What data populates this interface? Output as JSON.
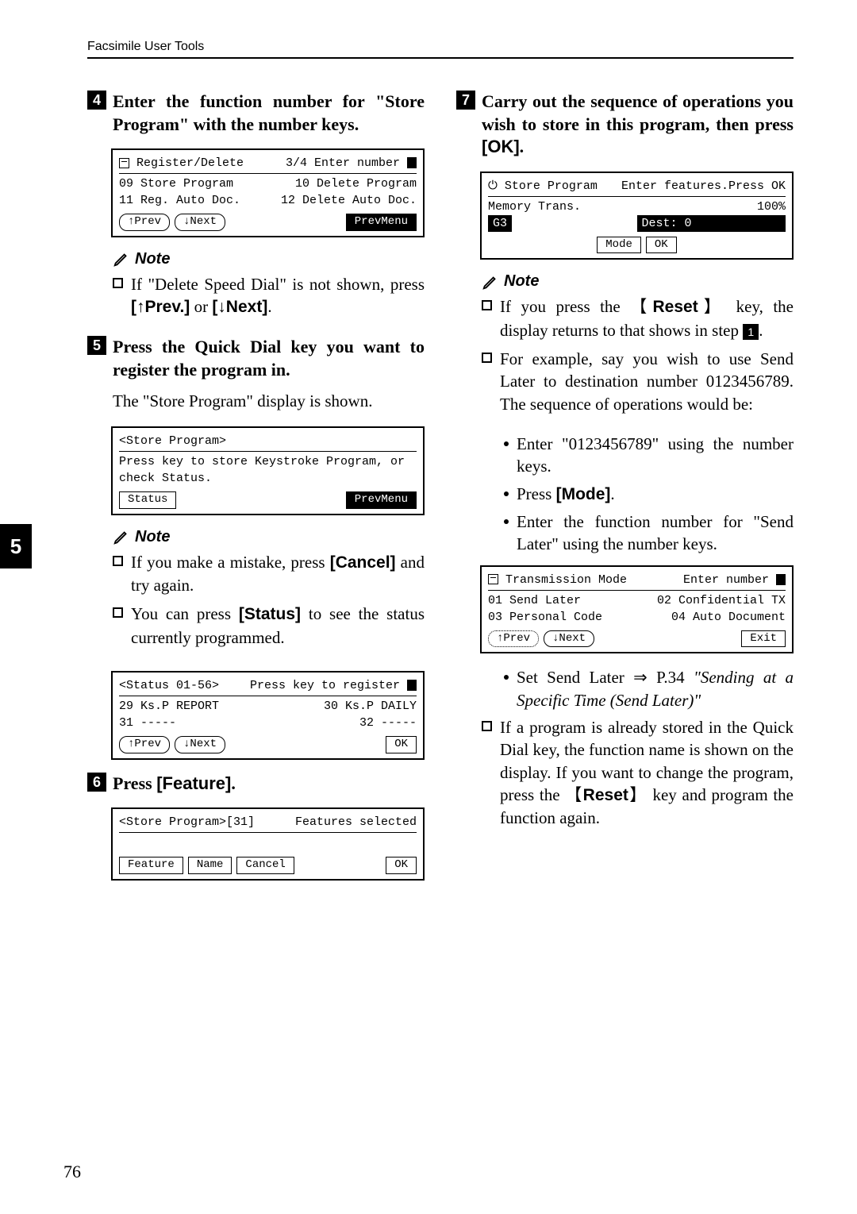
{
  "header": "Facsimile User Tools",
  "side_tab": "5",
  "page_number": "76",
  "left": {
    "step4": {
      "num": "4",
      "text": "Enter the function number for \"Store Program\" with the number keys."
    },
    "lcd1": {
      "title_l": "Register/Delete",
      "title_r": "3/4   Enter number",
      "row1_l": "09 Store Program",
      "row1_r": "10 Delete Program",
      "row2_l": "11 Reg. Auto Doc.",
      "row2_r": "12 Delete Auto Doc.",
      "btn_prev": "↑Prev",
      "btn_next": "↓Next",
      "btn_menu": "PrevMenu"
    },
    "note1_label": "Note",
    "note1_item": "If \"Delete Speed Dial\" is not shown, press ",
    "note1_prev": "[↑Prev.]",
    "note1_or": " or ",
    "note1_next": "[↓Next]",
    "step5": {
      "num": "5",
      "text": "Press the Quick Dial key you want to register the program in."
    },
    "body5": "The \"Store Program\" display is shown.",
    "lcd2": {
      "title": "<Store Program>",
      "line": "Press key to store Keystroke Program, or check Status.",
      "btn_status": "Status",
      "btn_menu": "PrevMenu"
    },
    "note2_label": "Note",
    "note2_item1a": "If you make a mistake, press ",
    "note2_item1b": "[Cancel]",
    "note2_item1c": " and try again.",
    "note2_item2a": "You can press ",
    "note2_item2b": "[Status]",
    "note2_item2c": " to see the status currently programmed.",
    "lcd3": {
      "title_l": "<Status 01-56>",
      "title_r": "Press key to register",
      "row1_l": "29 Ks.P REPORT",
      "row1_r": "30 Ks.P DAILY",
      "row2_l": "31 -----",
      "row2_r": "32 -----",
      "btn_prev": "↑Prev",
      "btn_next": "↓Next",
      "btn_ok": "OK"
    },
    "step6": {
      "num": "6",
      "text_a": "Press ",
      "text_b": "[Feature]"
    },
    "lcd4": {
      "title_l": "<Store Program>[31]",
      "title_r": "Features selected",
      "btn_feature": "Feature",
      "btn_name": "Name",
      "btn_cancel": "Cancel",
      "btn_ok": "OK"
    }
  },
  "right": {
    "step7": {
      "num": "7",
      "text_a": "Carry out the sequence of operations you wish to store in this program, then press ",
      "text_b": "[OK]"
    },
    "lcd5": {
      "title_l": "Store Program",
      "title_r": "Enter features.Press OK",
      "row1_l": "Memory Trans.",
      "row1_r": "100%",
      "g3": "G3",
      "dest": "Dest:  0",
      "btn_mode": "Mode",
      "btn_ok": "OK"
    },
    "note_label": "Note",
    "note_item1a": "If you press the ",
    "note_item1b": "Reset",
    "note_item1c": " key, the display returns to that shows in step ",
    "note_item1_step": "1",
    "note_item2": "For example, say you wish to use Send Later to destination number 0123456789. The sequence of operations would be:",
    "bullet1": "Enter \"0123456789\" using the number keys.",
    "bullet2a": "Press ",
    "bullet2b": "[Mode]",
    "bullet3": "Enter the function number for \"Send Later\" using the number keys.",
    "lcd6": {
      "title_l": "Transmission Mode",
      "title_r": "Enter number",
      "row1_l": "01 Send Later",
      "row1_r": "02 Confidential TX",
      "row2_l": "03 Personal Code",
      "row2_r": "04 Auto Document",
      "btn_prev": "↑Prev",
      "btn_next": "↓Next",
      "btn_exit": "Exit"
    },
    "bullet4a": "Set Send Later ⇒ P.34 ",
    "bullet4b": "\"Sending at a Specific Time (Send Later)\"",
    "note_item3a": "If a program is already stored in the Quick Dial key, the function name is shown on the display. If you want to change the program, press the ",
    "note_item3b": "Reset",
    "note_item3c": " key and program the function again."
  }
}
